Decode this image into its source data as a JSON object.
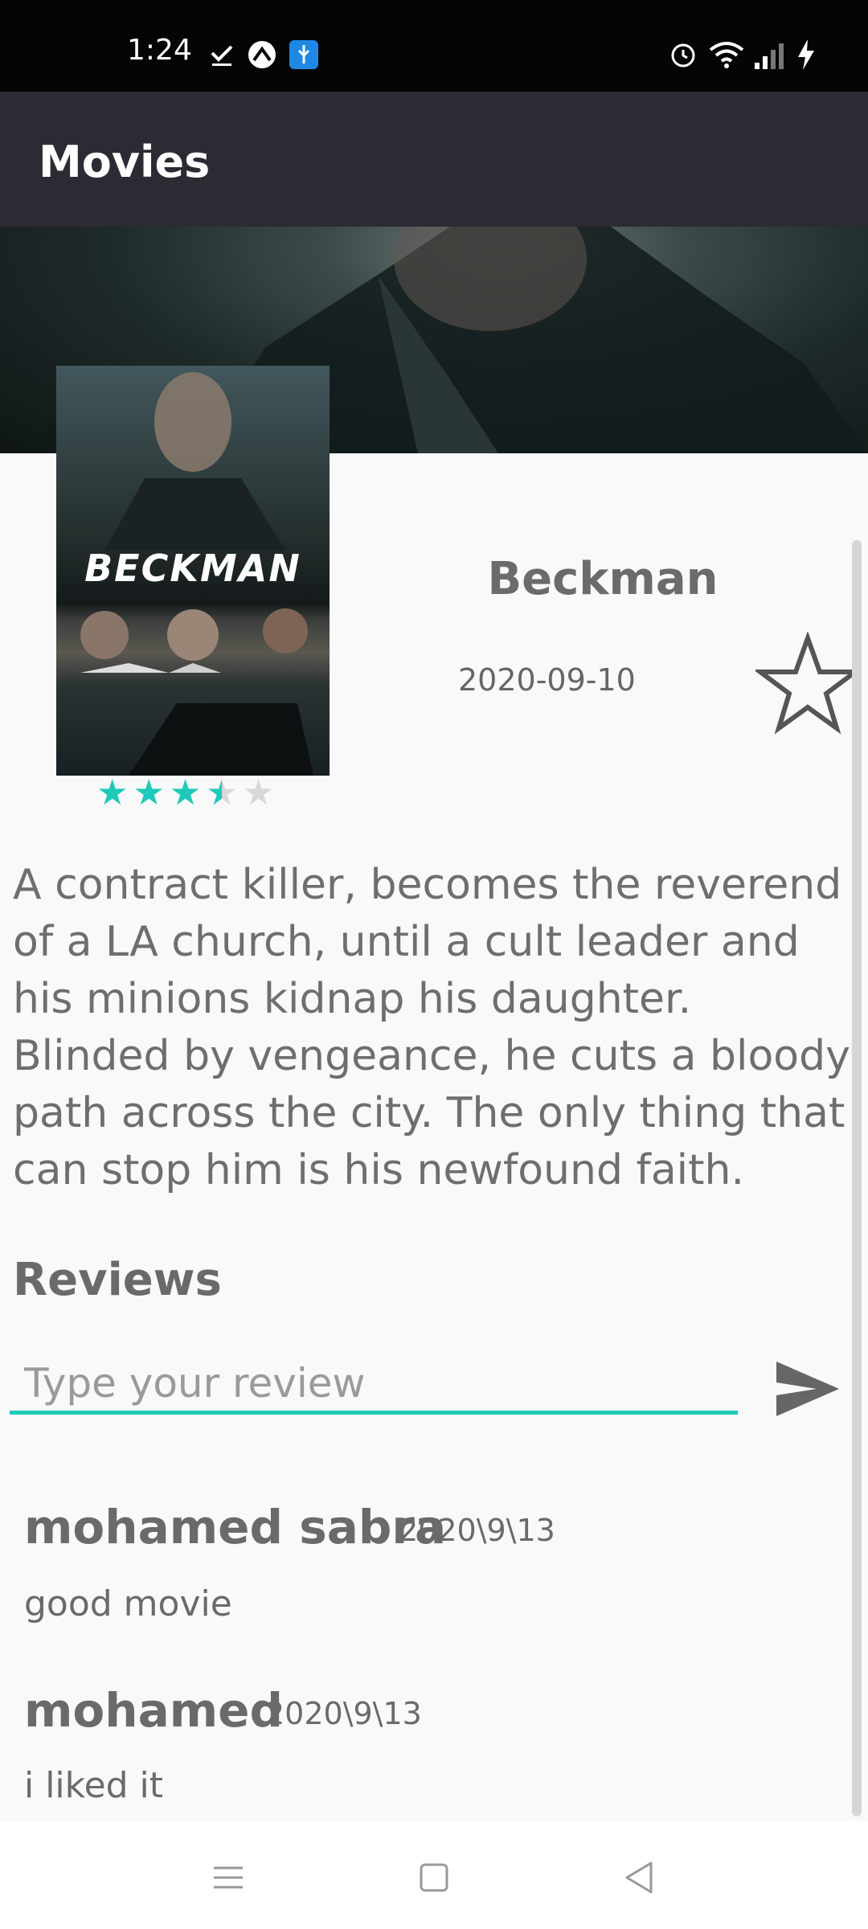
{
  "status_bar": {
    "time": "1:24",
    "left_icons": [
      "check-download-icon",
      "game-controller-icon",
      "usb-debug-icon"
    ],
    "right_icons": [
      "alarm-icon",
      "wifi-icon",
      "signal-icon",
      "charging-icon"
    ]
  },
  "app_bar": {
    "title": "Movies"
  },
  "movie": {
    "poster_title": "BECKMAN",
    "title": "Beckman",
    "release_date": "2020-09-10",
    "rating": {
      "value": 3.5,
      "max": 5
    },
    "favorite_icon": "star-outline-icon",
    "overview": "A contract killer, becomes the reverend of a LA church, until a cult leader and his minions kidnap his daughter. Blinded by vengeance, he cuts a bloody path across the city. The only thing that can stop him is his newfound faith."
  },
  "reviews": {
    "heading": "Reviews",
    "input_placeholder": "Type your review",
    "send_icon": "send-icon",
    "items": [
      {
        "author": "mohamed sabra",
        "date": "2020\\9\\13",
        "text": "good movie"
      },
      {
        "author": "mohamed",
        "date": "2020\\9\\13",
        "text": "i liked it"
      }
    ]
  },
  "colors": {
    "accent": "#1ec9b9",
    "app_bar": "#2d2a33",
    "text": "#6b6b6b"
  },
  "nav_bar": {
    "icons": [
      "menu-icon",
      "home-icon",
      "back-icon"
    ]
  }
}
